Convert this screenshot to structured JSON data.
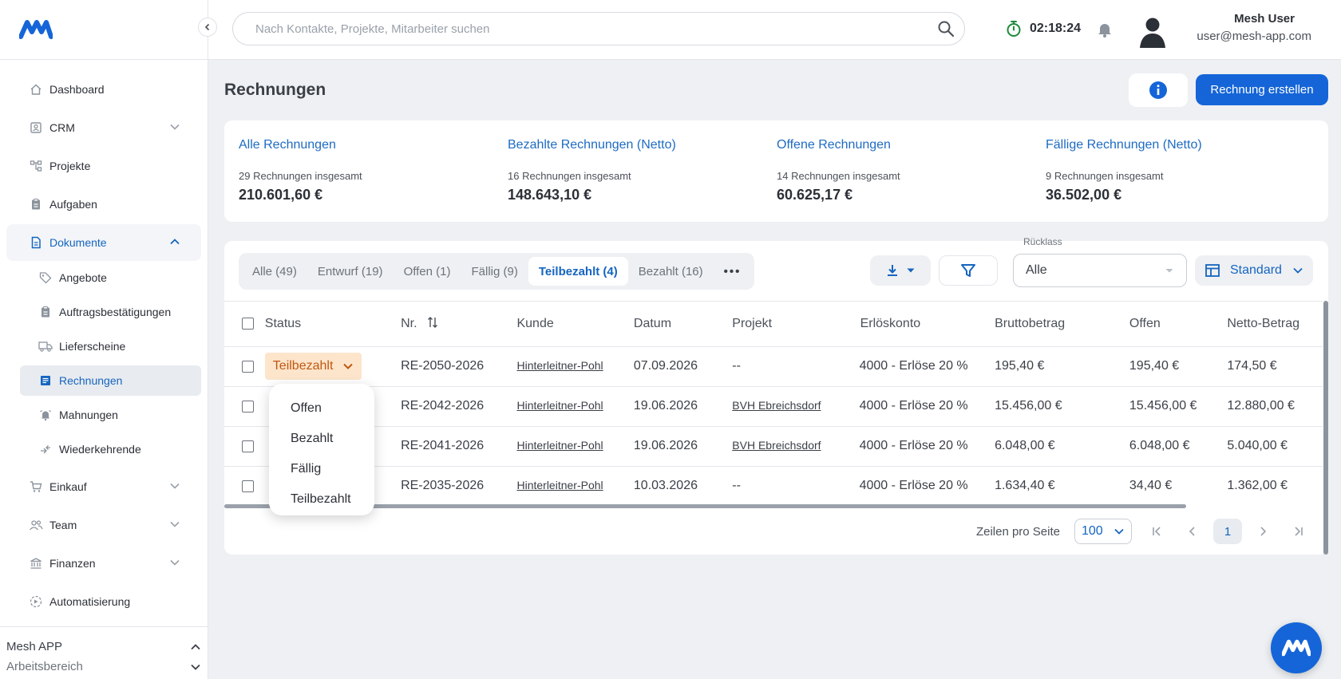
{
  "search": {
    "placeholder": "Nach Kontakte, Projekte, Mitarbeiter suchen"
  },
  "timer": {
    "value": "02:18:24"
  },
  "user": {
    "name": "Mesh User",
    "email": "user@mesh-app.com"
  },
  "sidebar": {
    "items": [
      {
        "label": "Dashboard"
      },
      {
        "label": "CRM"
      },
      {
        "label": "Projekte"
      },
      {
        "label": "Aufgaben"
      },
      {
        "label": "Dokumente"
      },
      {
        "label": "Einkauf"
      },
      {
        "label": "Team"
      },
      {
        "label": "Finanzen"
      },
      {
        "label": "Automatisierung"
      }
    ],
    "sub_items": [
      {
        "label": "Angebote"
      },
      {
        "label": "Auftragsbestätigungen"
      },
      {
        "label": "Lieferscheine"
      },
      {
        "label": "Rechnungen"
      },
      {
        "label": "Mahnungen"
      },
      {
        "label": "Wiederkehrende"
      }
    ],
    "footer": {
      "app": "Mesh APP",
      "workspace": "Arbeitsbereich"
    }
  },
  "page": {
    "title": "Rechnungen",
    "create_label": "Rechnung erstellen"
  },
  "stats": [
    {
      "title": "Alle Rechnungen",
      "sub": "29 Rechnungen insgesamt",
      "value": "210.601,60 €"
    },
    {
      "title": "Bezahlte Rechnungen (Netto)",
      "sub": "16 Rechnungen insgesamt",
      "value": "148.643,10 €"
    },
    {
      "title": "Offene Rechnungen",
      "sub": "14 Rechnungen insgesamt",
      "value": "60.625,17 €"
    },
    {
      "title": "Fällige Rechnungen (Netto)",
      "sub": "9 Rechnungen insgesamt",
      "value": "36.502,00 €"
    }
  ],
  "tabs": [
    {
      "label": "Alle (49)"
    },
    {
      "label": "Entwurf (19)"
    },
    {
      "label": "Offen (1)"
    },
    {
      "label": "Fällig (9)"
    },
    {
      "label": "Teilbezahlt (4)"
    },
    {
      "label": "Bezahlt (16)"
    },
    {
      "label": "•••"
    }
  ],
  "filter": {
    "label": "Rücklass",
    "value": "Alle"
  },
  "view": {
    "label": "Standard"
  },
  "table": {
    "headers": [
      "Status",
      "Nr.",
      "Kunde",
      "Datum",
      "Projekt",
      "Erlöskonto",
      "Bruttobetrag",
      "Offen",
      "Netto-Betrag"
    ],
    "rows": [
      {
        "status": "Teilbezahlt",
        "nr": "RE-2050-2026",
        "kunde": "Hinterleitner-Pohl",
        "datum": "07.09.2026",
        "projekt": "--",
        "konto": "4000 - Erlöse 20 %",
        "brutto": "195,40 €",
        "offen": "195,40 €",
        "netto": "174,50 €"
      },
      {
        "status": "",
        "nr": "RE-2042-2026",
        "kunde": "Hinterleitner-Pohl",
        "datum": "19.06.2026",
        "projekt": "BVH Ebreichsdorf",
        "konto": "4000 - Erlöse 20 %",
        "brutto": "15.456,00 €",
        "offen": "15.456,00 €",
        "netto": "12.880,00 €"
      },
      {
        "status": "",
        "nr": "RE-2041-2026",
        "kunde": "Hinterleitner-Pohl",
        "datum": "19.06.2026",
        "projekt": "BVH Ebreichsdorf",
        "konto": "4000 - Erlöse 20 %",
        "brutto": "6.048,00 €",
        "offen": "6.048,00 €",
        "netto": "5.040,00 €"
      },
      {
        "status": "",
        "nr": "RE-2035-2026",
        "kunde": "Hinterleitner-Pohl",
        "datum": "10.03.2026",
        "projekt": "--",
        "konto": "4000 - Erlöse 20 %",
        "brutto": "1.634,40 €",
        "offen": "34,40 €",
        "netto": "1.362,00 €"
      }
    ]
  },
  "dropdown": {
    "options": [
      "Offen",
      "Bezahlt",
      "Fällig",
      "Teilbezahlt"
    ]
  },
  "pager": {
    "rows_label": "Zeilen pro Seite",
    "rows_value": "100",
    "page": "1"
  },
  "colors": {
    "accent": "#1565d8",
    "status_bg": "#fde5cc",
    "status_fg": "#c0580f"
  }
}
